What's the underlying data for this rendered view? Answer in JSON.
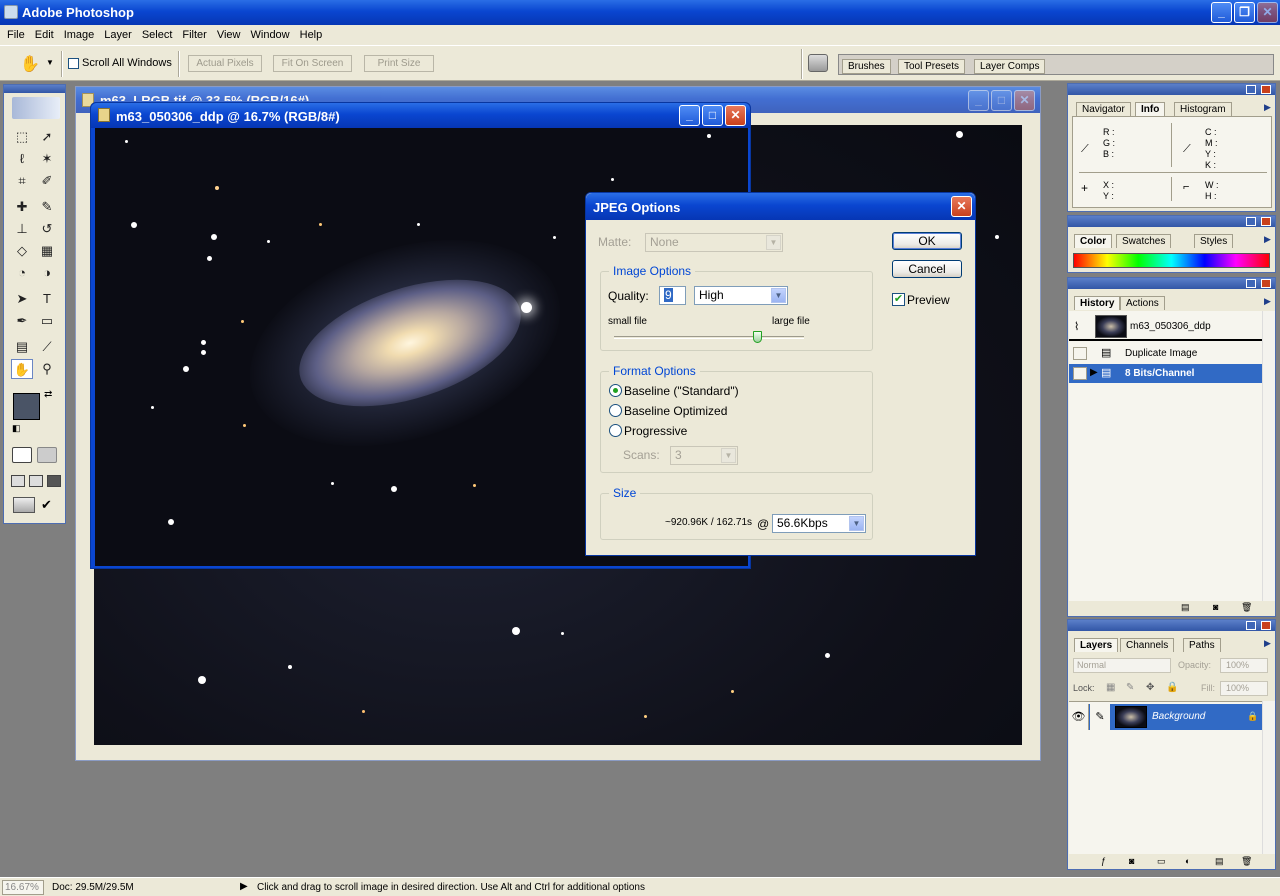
{
  "app": {
    "title": "Adobe Photoshop"
  },
  "menu": {
    "items": [
      "File",
      "Edit",
      "Image",
      "Layer",
      "Select",
      "Filter",
      "View",
      "Window",
      "Help"
    ]
  },
  "options_bar": {
    "scroll_all_windows": "Scroll All Windows",
    "actual_pixels": "Actual Pixels",
    "fit_on_screen": "Fit On Screen",
    "print_size": "Print Size"
  },
  "palette_well": {
    "tabs": [
      "Brushes",
      "Tool Presets",
      "Layer Comps"
    ]
  },
  "documents": {
    "back_title": "m63_LRGB.tif @ 33.5% (RGB/16#)",
    "front_title": "m63_050306_ddp @ 16.7% (RGB/8#)"
  },
  "dialog": {
    "title": "JPEG Options",
    "matte_label": "Matte:",
    "matte_value": "None",
    "image_options_title": "Image Options",
    "quality_label": "Quality:",
    "quality_value": "9",
    "quality_preset": "High",
    "small_file": "small file",
    "large_file": "large file",
    "quality_fraction": 0.75,
    "format_options_title": "Format Options",
    "baseline_standard": "Baseline (\"Standard\")",
    "baseline_optimized": "Baseline Optimized",
    "progressive": "Progressive",
    "scans_label": "Scans:",
    "scans_value": "3",
    "size_title": "Size",
    "size_value": "~920.96K / 162.71s",
    "at": "@",
    "speed": "56.6Kbps",
    "ok": "OK",
    "cancel": "Cancel",
    "preview": "Preview",
    "preview_checked": true
  },
  "info_panel": {
    "tabs": [
      "Navigator",
      "Info",
      "Histogram"
    ],
    "rgb": [
      "R :",
      "G :",
      "B :"
    ],
    "cmyk": [
      "C :",
      "M :",
      "Y :",
      "K :"
    ],
    "xy": [
      "X :",
      "Y :"
    ],
    "wh": [
      "W :",
      "H :"
    ]
  },
  "color_panel": {
    "tabs": [
      "Color",
      "Swatches",
      "Styles"
    ]
  },
  "history_panel": {
    "tabs": [
      "History",
      "Actions"
    ],
    "snapshot": "m63_050306_ddp",
    "steps": [
      "Duplicate Image",
      "8 Bits/Channel"
    ]
  },
  "layers_panel": {
    "tabs": [
      "Layers",
      "Channels",
      "Paths"
    ],
    "blend_mode": "Normal",
    "opacity_label": "Opacity:",
    "opacity_value": "100%",
    "lock_label": "Lock:",
    "fill_label": "Fill:",
    "fill_value": "100%",
    "layer_name": "Background"
  },
  "status_bar": {
    "zoom": "16.67%",
    "doc": "Doc: 29.5M/29.5M",
    "hint": "Click and drag to scroll image in desired direction.  Use Alt and Ctrl for additional options"
  },
  "colors": {
    "xp_blue": "#0a46d0",
    "selection": "#316ac5",
    "dialog_bg": "#ece9d8"
  }
}
